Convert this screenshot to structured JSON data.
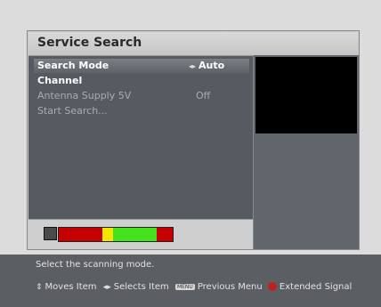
{
  "dialog": {
    "title": "Service Search"
  },
  "menu": {
    "items": [
      {
        "label": "Search Mode",
        "value": "Auto",
        "selected": true
      },
      {
        "label": "Channel",
        "value": ""
      },
      {
        "label": "Antenna Supply 5V",
        "value": "Off"
      },
      {
        "label": "Start Search...",
        "value": ""
      }
    ],
    "left_right_arrows": "◂▸"
  },
  "signal": {
    "segments": [
      {
        "color": "#c40000",
        "fraction": 0.38
      },
      {
        "color": "#f3e600",
        "fraction": 0.1
      },
      {
        "color": "#44e31e",
        "fraction": 0.38
      },
      {
        "color": "#c40000",
        "fraction": 0.14
      }
    ]
  },
  "footer": {
    "hint": "Select the scanning mode.",
    "key_moves": "Moves Item",
    "key_selects": "Selects Item",
    "menu_badge": "MENU",
    "key_previous": "Previous Menu",
    "key_extended": "Extended Signal"
  }
}
